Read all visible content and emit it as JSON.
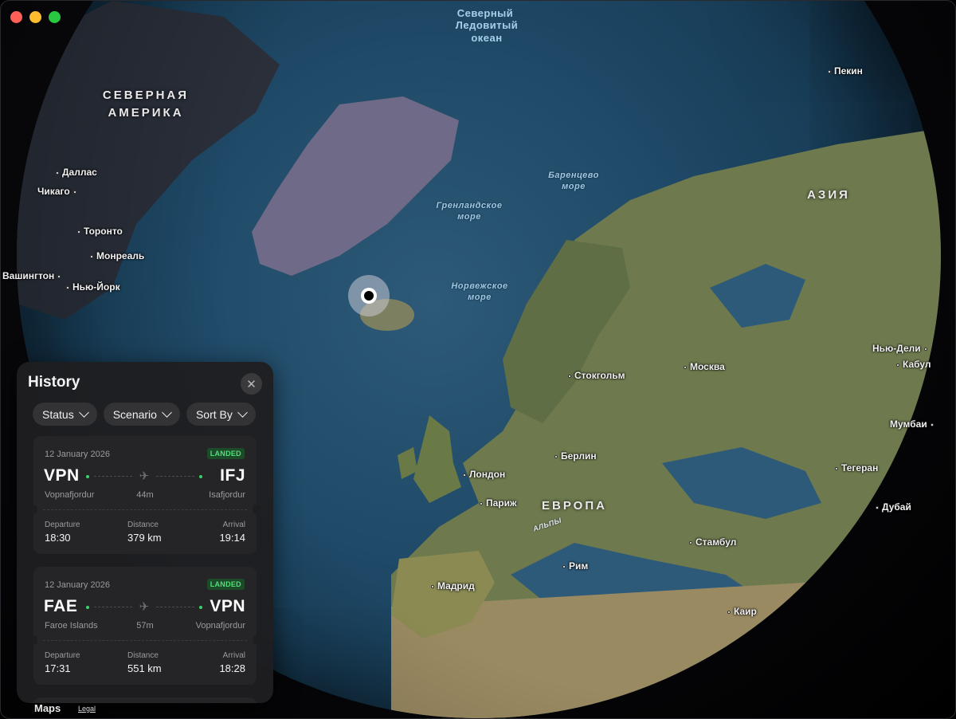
{
  "window": {
    "controls": [
      "close",
      "minimize",
      "zoom"
    ]
  },
  "map": {
    "continents": {
      "north_america": "СЕВЕРНАЯ\nАМЕРИКА",
      "europe": "ЕВРОПА",
      "asia": "АЗИЯ"
    },
    "seas": {
      "arctic_ocean": "Ледовитый\nокеан",
      "arctic_ocean_partial": "Северный",
      "barents": "Баренцево\nморе",
      "greenland": "Гренландское\nморе",
      "norwegian": "Норвежское\nморе",
      "alps": "АЛЬПЫ"
    },
    "cities": {
      "dallas": "Даллас",
      "chicago": "Чикаго",
      "toronto": "Торонто",
      "montreal": "Монреаль",
      "washington": "Вашингтон",
      "new_york": "Нью-Йорк",
      "beijing": "Пекин",
      "stockholm": "Стокгольм",
      "moscow": "Москва",
      "new_delhi": "Нью-Дели",
      "kabul": "Кабул",
      "mumbai": "Мумбаи",
      "tehran": "Тегеран",
      "dubai": "Дубай",
      "berlin": "Берлин",
      "london": "Лондон",
      "paris": "Париж",
      "istanbul": "Стамбул",
      "rome": "Рим",
      "madrid": "Мадрид",
      "cairo": "Каир"
    },
    "attribution": {
      "maps_label": "Maps",
      "legal_label": "Legal"
    }
  },
  "history": {
    "title": "History",
    "close_icon": "xmark",
    "filters": [
      {
        "label": "Status"
      },
      {
        "label": "Scenario"
      },
      {
        "label": "Sort By"
      }
    ],
    "flights": [
      {
        "date": "12 January 2026",
        "status": "LANDED",
        "from_code": "VPN",
        "from_city": "Vopnafjordur",
        "to_code": "IFJ",
        "to_city": "Isafjordur",
        "duration": "44m",
        "departure_label": "Departure",
        "departure": "18:30",
        "distance_label": "Distance",
        "distance": "379 km",
        "arrival_label": "Arrival",
        "arrival": "19:14"
      },
      {
        "date": "12 January 2026",
        "status": "LANDED",
        "from_code": "FAE",
        "from_city": "Faroe Islands",
        "to_code": "VPN",
        "to_city": "Vopnafjordur",
        "duration": "57m",
        "departure_label": "Departure",
        "departure": "17:31",
        "distance_label": "Distance",
        "distance": "551 km",
        "arrival_label": "Arrival",
        "arrival": "18:28"
      }
    ]
  },
  "colors": {
    "status_green": "#4fe07a",
    "panel_bg": "#1e1e20",
    "card_bg": "#252528"
  }
}
